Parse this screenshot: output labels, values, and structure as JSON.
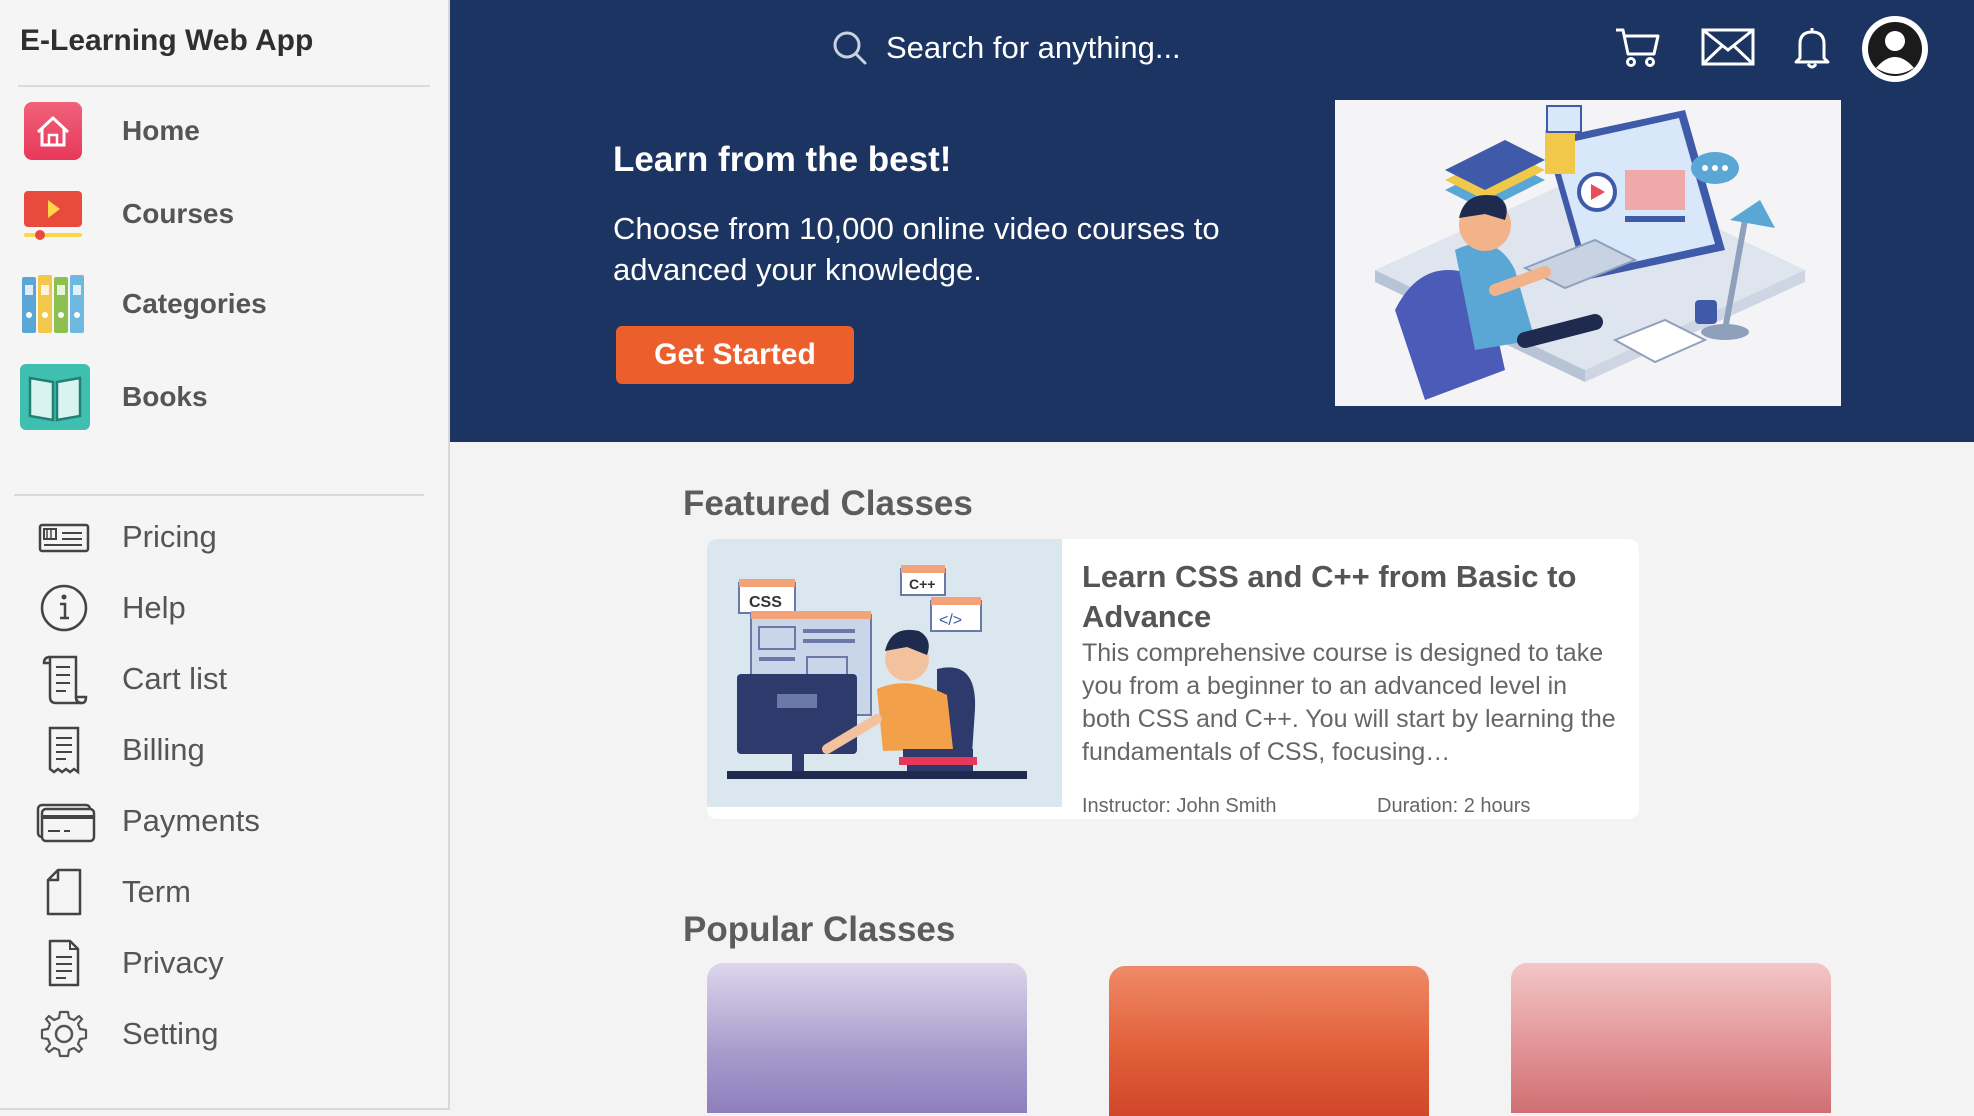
{
  "app": {
    "title": "E-Learning Web App"
  },
  "sidebar": {
    "main_items": [
      {
        "label": "Home",
        "icon": "home-icon"
      },
      {
        "label": "Courses",
        "icon": "video-icon"
      },
      {
        "label": "Categories",
        "icon": "binders-icon"
      },
      {
        "label": "Books",
        "icon": "book-icon"
      }
    ],
    "sub_items": [
      {
        "label": "Pricing",
        "icon": "price-card-icon"
      },
      {
        "label": "Help",
        "icon": "info-icon"
      },
      {
        "label": "Cart list",
        "icon": "scroll-icon"
      },
      {
        "label": "Billing",
        "icon": "receipt-icon"
      },
      {
        "label": "Payments",
        "icon": "credit-card-icon"
      },
      {
        "label": "Term",
        "icon": "page-icon"
      },
      {
        "label": "Privacy",
        "icon": "document-icon"
      },
      {
        "label": "Setting",
        "icon": "gear-icon"
      }
    ]
  },
  "header": {
    "search_placeholder": "Search for anything...",
    "icons": [
      "cart-icon",
      "mail-icon",
      "bell-icon",
      "avatar"
    ]
  },
  "hero": {
    "title": "Learn from the best!",
    "subtitle": "Choose from 10,000 online video courses to advanced your knowledge.",
    "cta": "Get Started"
  },
  "featured": {
    "heading": "Featured Classes",
    "course": {
      "title": "Learn CSS and C++ from Basic to Advance",
      "description": "This comprehensive course is designed to take you from a beginner to an advanced level in both CSS and C++. You will start by learning the fundamentals of CSS, focusing…",
      "instructor": "Instructor: John Smith",
      "duration": "Duration: 2 hours",
      "image_labels": {
        "css": "CSS",
        "cpp": "C++",
        "code": "</>"
      }
    }
  },
  "popular": {
    "heading": "Popular Classes"
  },
  "colors": {
    "hero_bg": "#1c3461",
    "accent": "#ec5f2c",
    "sidebar_bg": "#f5f5f5",
    "content_bg": "#f3f3f3"
  }
}
